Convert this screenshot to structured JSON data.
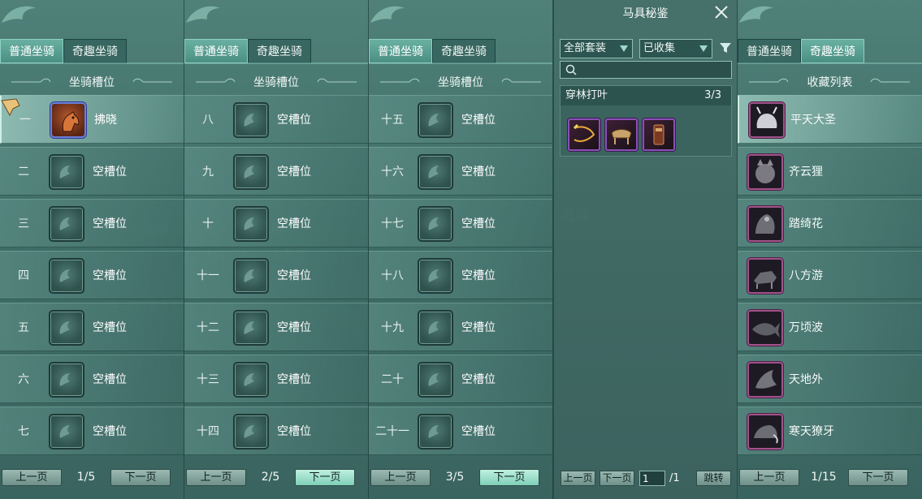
{
  "colors": {
    "accent": "#69b0a2",
    "panel_bg": "#4e7a72",
    "epic_border": "#a0528a",
    "set_item_border": "#8a4fb6"
  },
  "tabs": {
    "normal": "普通坐骑",
    "fun": "奇趣坐骑"
  },
  "slot_panels": [
    {
      "section_title": "坐骑槽位",
      "rows": [
        {
          "num": "一",
          "label": "拂晓",
          "filled": true
        },
        {
          "num": "二",
          "label": "空槽位"
        },
        {
          "num": "三",
          "label": "空槽位"
        },
        {
          "num": "四",
          "label": "空槽位"
        },
        {
          "num": "五",
          "label": "空槽位"
        },
        {
          "num": "六",
          "label": "空槽位"
        },
        {
          "num": "七",
          "label": "空槽位"
        }
      ],
      "pager": {
        "prev": "上一页",
        "page": "1/5",
        "next": "下一页"
      }
    },
    {
      "section_title": "坐骑槽位",
      "rows": [
        {
          "num": "八",
          "label": "空槽位"
        },
        {
          "num": "九",
          "label": "空槽位"
        },
        {
          "num": "十",
          "label": "空槽位"
        },
        {
          "num": "十一",
          "label": "空槽位"
        },
        {
          "num": "十二",
          "label": "空槽位"
        },
        {
          "num": "十三",
          "label": "空槽位"
        },
        {
          "num": "十四",
          "label": "空槽位"
        }
      ],
      "pager": {
        "prev": "上一页",
        "page": "2/5",
        "next": "下一页"
      }
    },
    {
      "section_title": "坐骑槽位",
      "rows": [
        {
          "num": "十五",
          "label": "空槽位"
        },
        {
          "num": "十六",
          "label": "空槽位"
        },
        {
          "num": "十七",
          "label": "空槽位"
        },
        {
          "num": "十八",
          "label": "空槽位"
        },
        {
          "num": "十九",
          "label": "空槽位"
        },
        {
          "num": "二十",
          "label": "空槽位"
        },
        {
          "num": "二十一",
          "label": "空槽位"
        }
      ],
      "pager": {
        "prev": "上一页",
        "page": "3/5",
        "next": "下一页"
      }
    }
  ],
  "encyclopedia": {
    "title": "马具秘鉴",
    "set_filter": "全部套装",
    "collect_filter": "已收集",
    "search_placeholder": "",
    "set_name": "穿林打叶",
    "set_count": "3/3",
    "gear_icons": [
      "whip-icon",
      "saddle-icon",
      "stirrup-icon"
    ],
    "pager": {
      "prev": "上一页",
      "next": "下一页",
      "page_value": "1",
      "total": "/1",
      "jump": "跳转"
    }
  },
  "collection": {
    "section_title": "收藏列表",
    "items": [
      {
        "name": "平天大圣",
        "icon": "bull-demon-icon"
      },
      {
        "name": "齐云狸",
        "icon": "raccoon-icon"
      },
      {
        "name": "踏绮花",
        "icon": "flower-beast-icon"
      },
      {
        "name": "八方游",
        "icon": "beast-icon"
      },
      {
        "name": "万顷波",
        "icon": "fish-icon"
      },
      {
        "name": "天地外",
        "icon": "dragon-icon"
      },
      {
        "name": "寒天獠牙",
        "icon": "tusk-beast-icon"
      }
    ],
    "pager": {
      "prev": "上一页",
      "page": "1/15",
      "next": "下一页"
    }
  }
}
